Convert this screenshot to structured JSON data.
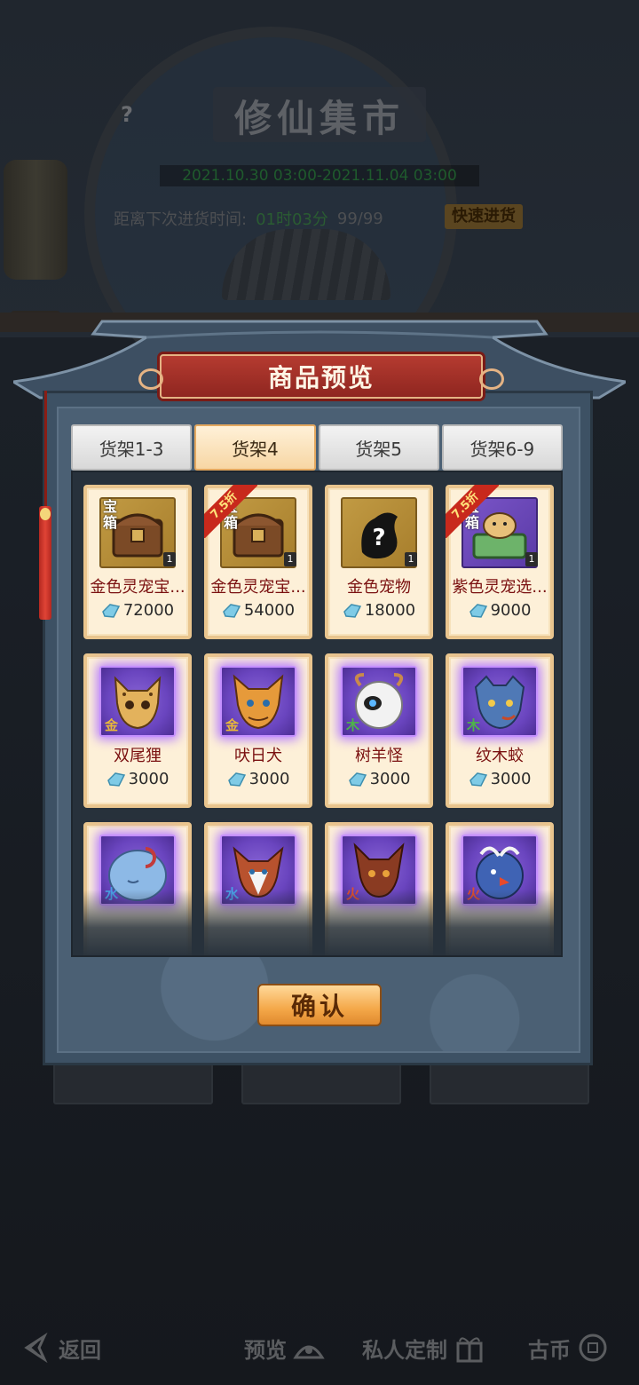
{
  "background": {
    "market_title": "修仙集市",
    "help_icon": "?",
    "date_range": "2021.10.30 03:00-2021.11.04 03:00",
    "next_restock_label": "距离下次进货时间:",
    "next_restock_timer": "01时03分",
    "restock_count": "99/99",
    "fast_restock_label": "快速进货"
  },
  "dialog": {
    "title": "商品预览",
    "confirm_label": "确认",
    "tabs": [
      {
        "label": "货架1-3",
        "active": false
      },
      {
        "label": "货架4",
        "active": true
      },
      {
        "label": "货架5",
        "active": false
      },
      {
        "label": "货架6-9",
        "active": false
      }
    ],
    "items": [
      {
        "name": "金色灵宠宝...",
        "price": "72000",
        "quantity": "1",
        "frame": "gold",
        "icon": "treasure-chest-icon",
        "tag": "宝箱",
        "discount": ""
      },
      {
        "name": "金色灵宠宝...",
        "price": "54000",
        "quantity": "1",
        "frame": "gold",
        "icon": "treasure-chest-icon",
        "tag": "宝箱",
        "discount": "7.5折"
      },
      {
        "name": "金色宠物",
        "price": "18000",
        "quantity": "1",
        "frame": "gold",
        "icon": "mystery-pet-icon",
        "tag": "",
        "discount": ""
      },
      {
        "name": "紫色灵宠选...",
        "price": "9000",
        "quantity": "1",
        "frame": "purple",
        "icon": "pet-selection-chest-icon",
        "tag": "宝箱",
        "discount": "7.5折"
      },
      {
        "name": "双尾狸",
        "price": "3000",
        "frame": "purple",
        "icon": "leopard-cat-pet-icon",
        "element": "金",
        "discount": ""
      },
      {
        "name": "吠日犬",
        "price": "3000",
        "frame": "purple",
        "icon": "sun-dog-pet-icon",
        "element": "金",
        "discount": ""
      },
      {
        "name": "树羊怪",
        "price": "3000",
        "frame": "purple",
        "icon": "tree-goat-pet-icon",
        "element": "木",
        "discount": ""
      },
      {
        "name": "纹木蛟",
        "price": "3000",
        "frame": "purple",
        "icon": "wood-dragon-pet-icon",
        "element": "木",
        "discount": ""
      },
      {
        "name": "",
        "price": "",
        "frame": "purple",
        "icon": "water-beast-pet-icon",
        "element": "水",
        "discount": ""
      },
      {
        "name": "",
        "price": "",
        "frame": "purple",
        "icon": "deer-pet-icon",
        "element": "水",
        "discount": ""
      },
      {
        "name": "",
        "price": "",
        "frame": "purple",
        "icon": "fire-fox-pet-icon",
        "element": "火",
        "discount": ""
      },
      {
        "name": "",
        "price": "",
        "frame": "purple",
        "icon": "fire-bird-pet-icon",
        "element": "火",
        "discount": ""
      }
    ]
  },
  "bottom_nav": {
    "back": "返回",
    "preview": "预览",
    "custom": "私人定制",
    "coins": "古币"
  },
  "colors": {
    "dialog_title_bg": "#b53b30",
    "price_text": "#2a2a2a",
    "item_name": "#7a1010",
    "active_tab": "#f7d6a4",
    "confirm_button": "#f4a849"
  }
}
